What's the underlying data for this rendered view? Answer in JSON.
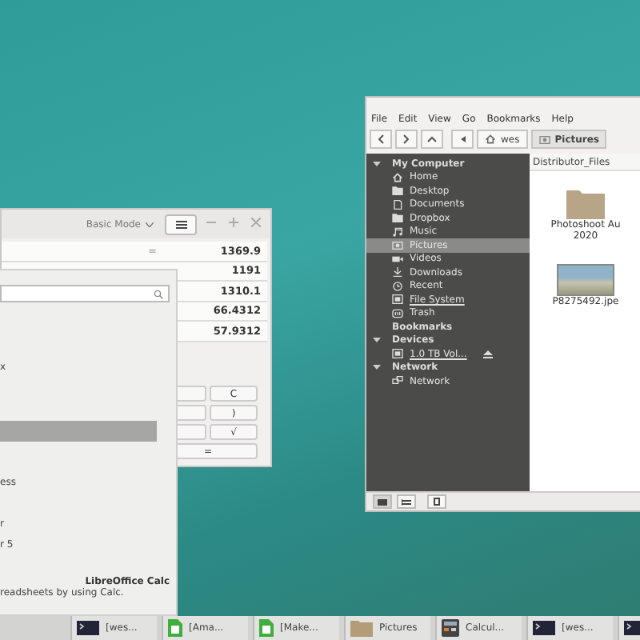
{
  "calculator": {
    "mode": "Basic Mode",
    "history": [
      {
        "op": "=",
        "value": "1369.9"
      },
      {
        "value": "1191"
      },
      {
        "value": "1310.1"
      },
      {
        "value": "66.4312"
      },
      {
        "value": "57.9312"
      }
    ],
    "buttons": [
      "C",
      ")",
      "√"
    ],
    "equals": "="
  },
  "menu": {
    "rows": [
      {
        "label": "x",
        "selected": false
      },
      {
        "selected": true
      },
      {
        "label": "ess",
        "selected": false
      },
      {
        "label": "r",
        "selected": false
      },
      {
        "label": "r 5",
        "selected": false
      }
    ],
    "app_name": "LibreOffice Calc",
    "app_description": "readsheets by using Calc."
  },
  "file_manager": {
    "menubar": [
      "File",
      "Edit",
      "View",
      "Go",
      "Bookmarks",
      "Help"
    ],
    "path": [
      {
        "label": "wes",
        "kind": "home",
        "selected": false
      },
      {
        "label": "Pictures",
        "kind": "camera",
        "selected": true
      }
    ],
    "sidebar": [
      {
        "label": "My Computer",
        "expanded": true,
        "children": [
          {
            "label": "Home",
            "kind": "home",
            "selected": false
          },
          {
            "label": "Desktop",
            "kind": "folder",
            "selected": false
          },
          {
            "label": "Documents",
            "kind": "doc",
            "selected": false
          },
          {
            "label": "Dropbox",
            "kind": "folder",
            "selected": false
          },
          {
            "label": "Music",
            "kind": "music",
            "selected": false
          },
          {
            "label": "Pictures",
            "kind": "camera",
            "selected": true
          },
          {
            "label": "Videos",
            "kind": "video",
            "selected": false
          },
          {
            "label": "Downloads",
            "kind": "download",
            "selected": false
          },
          {
            "label": "Recent",
            "kind": "clock",
            "selected": false
          },
          {
            "label": "File System",
            "kind": "drive",
            "selected": false
          },
          {
            "label": "Trash",
            "kind": "trash",
            "selected": false
          }
        ]
      },
      {
        "label": "Bookmarks"
      },
      {
        "label": "Devices",
        "expanded": true,
        "children": [
          {
            "label": "1.0 TB Vol...",
            "kind": "drive",
            "selected": false,
            "eject": true
          }
        ]
      },
      {
        "label": "Network",
        "expanded": true,
        "children": [
          {
            "label": "Network",
            "kind": "network",
            "selected": false
          }
        ]
      }
    ],
    "column_header": "Distributor_Files",
    "files": [
      {
        "kind": "folder",
        "name": "Photoshoot Au",
        "name_2": "2020"
      },
      {
        "kind": "image",
        "name": "P8275492.jpe"
      }
    ]
  },
  "taskbar": [
    {
      "kind": "terminal",
      "label": "[wes..."
    },
    {
      "kind": "sheet",
      "label": "[Ama..."
    },
    {
      "kind": "sheet",
      "label": "[Make..."
    },
    {
      "kind": "folder",
      "label": "Pictures"
    },
    {
      "kind": "calculator",
      "label": "Calcul..."
    },
    {
      "kind": "terminal",
      "label": "[wes..."
    },
    {
      "kind": "terminal"
    }
  ]
}
